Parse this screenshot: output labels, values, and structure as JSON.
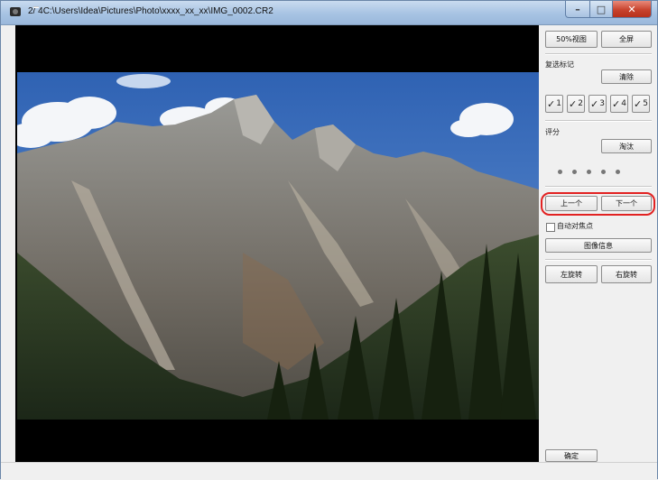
{
  "window": {
    "index": "2/",
    "count": "4",
    "path": "C:\\Users\\Idea\\Pictures\\Photo\\xxxx_xx_xx\\IMG_0002.CR2",
    "min_glyph": "–",
    "max_glyph": "□",
    "close_glyph": "✕"
  },
  "panel": {
    "view50_label": "50%视图",
    "fullscreen_label": "全屏",
    "check_mark_heading": "复选标记",
    "clear_label": "清除",
    "check_buttons": [
      {
        "glyph": "✓",
        "num": "1"
      },
      {
        "glyph": "✓",
        "num": "2"
      },
      {
        "glyph": "✓",
        "num": "3"
      },
      {
        "glyph": "✓",
        "num": "4"
      },
      {
        "glyph": "✓",
        "num": "5"
      }
    ],
    "rating_heading": "评分",
    "reject_label": "淘汰",
    "prev_label": "上一个",
    "next_label": "下一个",
    "auto_af_label": "自动对焦点",
    "image_info_label": "图像信息",
    "rotate_left_label": "左旋转",
    "rotate_right_label": "右旋转",
    "ok_label": "确定"
  },
  "colors": {
    "highlight": "#e22222",
    "viewer_bg": "#000000"
  },
  "icons": {
    "app": "camera-icon",
    "rating": "star-dot-icon"
  }
}
